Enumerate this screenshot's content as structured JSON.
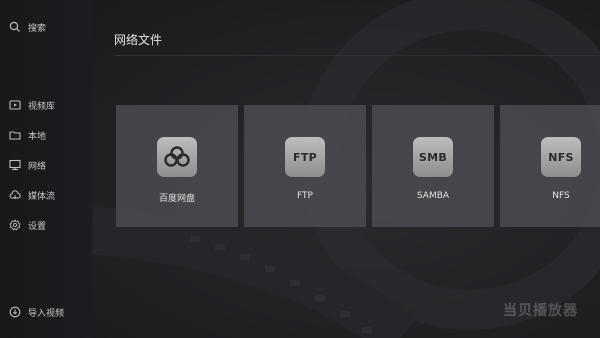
{
  "sidebar": {
    "search": {
      "label": "搜索",
      "icon": "search-icon"
    },
    "items": [
      {
        "label": "视频库",
        "icon": "video-library-icon"
      },
      {
        "label": "本地",
        "icon": "folder-icon"
      },
      {
        "label": "网络",
        "icon": "network-icon"
      },
      {
        "label": "媒体流",
        "icon": "cloud-icon"
      },
      {
        "label": "设置",
        "icon": "gear-icon"
      }
    ],
    "import": {
      "label": "导入视频",
      "icon": "import-icon"
    }
  },
  "main": {
    "title": "网络文件",
    "cards": [
      {
        "label": "百度网盘",
        "icon": "baidu-cloud-icon",
        "icon_text": ""
      },
      {
        "label": "FTP",
        "icon": "ftp-icon",
        "icon_text": "FTP"
      },
      {
        "label": "SAMBA",
        "icon": "smb-icon",
        "icon_text": "SMB"
      },
      {
        "label": "NFS",
        "icon": "nfs-icon",
        "icon_text": "NFS"
      }
    ]
  },
  "watermark": "当贝播放器",
  "colors": {
    "background": "#1b1c1e",
    "card": "#4e5054",
    "icon_tile": "#a8a8a8"
  }
}
